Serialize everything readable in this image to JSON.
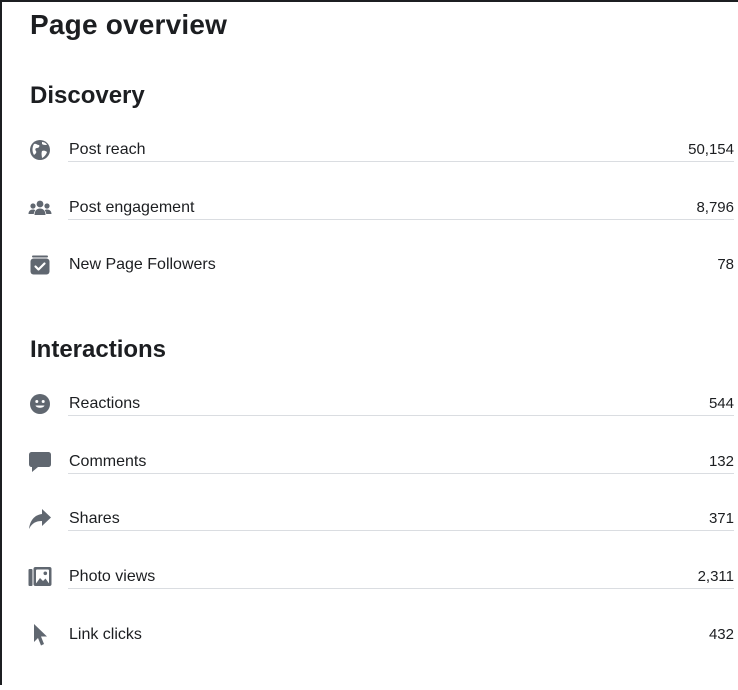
{
  "page_title": "Page overview",
  "discovery": {
    "title": "Discovery",
    "items": [
      {
        "icon": "globe-icon",
        "label": "Post reach",
        "value": "50,154"
      },
      {
        "icon": "people-icon",
        "label": "Post engagement",
        "value": "8,796"
      },
      {
        "icon": "followers-icon",
        "label": "New Page Followers",
        "value": "78"
      }
    ]
  },
  "interactions": {
    "title": "Interactions",
    "items": [
      {
        "icon": "smiley-icon",
        "label": "Reactions",
        "value": "544"
      },
      {
        "icon": "comment-icon",
        "label": "Comments",
        "value": "132"
      },
      {
        "icon": "share-icon",
        "label": "Shares",
        "value": "371"
      },
      {
        "icon": "photo-icon",
        "label": "Photo views",
        "value": "2,311"
      },
      {
        "icon": "cursor-icon",
        "label": "Link clicks",
        "value": "432"
      }
    ]
  },
  "colors": {
    "text": "#1c1e21",
    "icon": "#606770",
    "divider": "#dadde1"
  }
}
